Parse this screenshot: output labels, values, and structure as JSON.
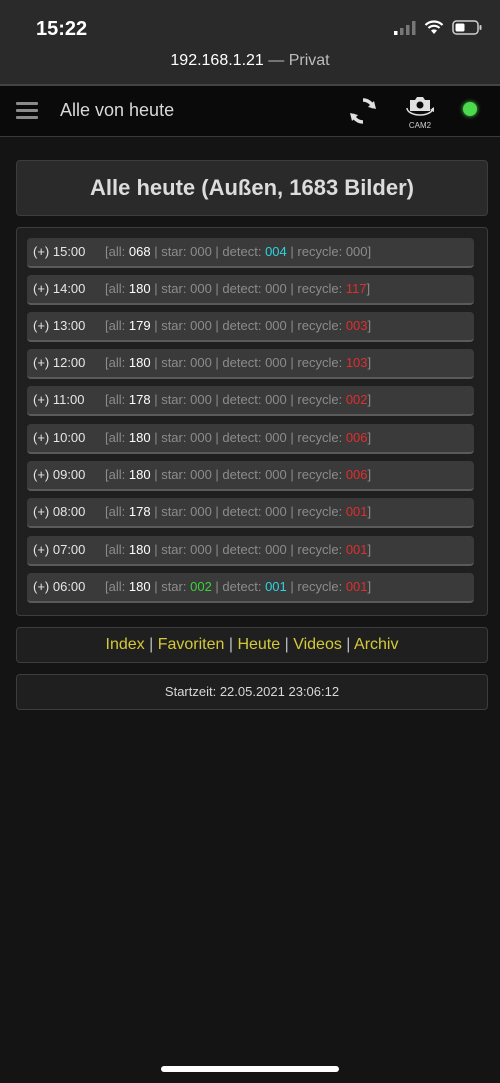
{
  "status_bar": {
    "time": "15:22"
  },
  "browser": {
    "url": "192.168.1.21",
    "url_suffix": "— Privat"
  },
  "header": {
    "title": "Alle von heute",
    "cam_label": "CAM2"
  },
  "page_title": "Alle heute (Außen, 1683 Bilder)",
  "labels": {
    "all": "all:",
    "star": "star:",
    "detect": "detect:",
    "recycle": "recycle:"
  },
  "hours": [
    {
      "label": "(+) 15:00",
      "all": "068",
      "star": "000",
      "detect": "004",
      "recycle": "000"
    },
    {
      "label": "(+) 14:00",
      "all": "180",
      "star": "000",
      "detect": "000",
      "recycle": "117"
    },
    {
      "label": "(+) 13:00",
      "all": "179",
      "star": "000",
      "detect": "000",
      "recycle": "003"
    },
    {
      "label": "(+) 12:00",
      "all": "180",
      "star": "000",
      "detect": "000",
      "recycle": "103"
    },
    {
      "label": "(+) 11:00",
      "all": "178",
      "star": "000",
      "detect": "000",
      "recycle": "002"
    },
    {
      "label": "(+) 10:00",
      "all": "180",
      "star": "000",
      "detect": "000",
      "recycle": "006"
    },
    {
      "label": "(+) 09:00",
      "all": "180",
      "star": "000",
      "detect": "000",
      "recycle": "006"
    },
    {
      "label": "(+) 08:00",
      "all": "178",
      "star": "000",
      "detect": "000",
      "recycle": "001"
    },
    {
      "label": "(+) 07:00",
      "all": "180",
      "star": "000",
      "detect": "000",
      "recycle": "001"
    },
    {
      "label": "(+) 06:00",
      "all": "180",
      "star": "002",
      "detect": "001",
      "recycle": "001"
    }
  ],
  "nav": {
    "index": "Index",
    "favoriten": "Favoriten",
    "heute": "Heute",
    "videos": "Videos",
    "archiv": "Archiv"
  },
  "start_time": "Startzeit: 22.05.2021 23:06:12",
  "colors": {
    "link": "#d4c93a",
    "highlight_detect": "#2ed3e0",
    "highlight_recycle": "#e02e2e",
    "highlight_star": "#3ad13a",
    "status_ok": "#4cd94c"
  }
}
